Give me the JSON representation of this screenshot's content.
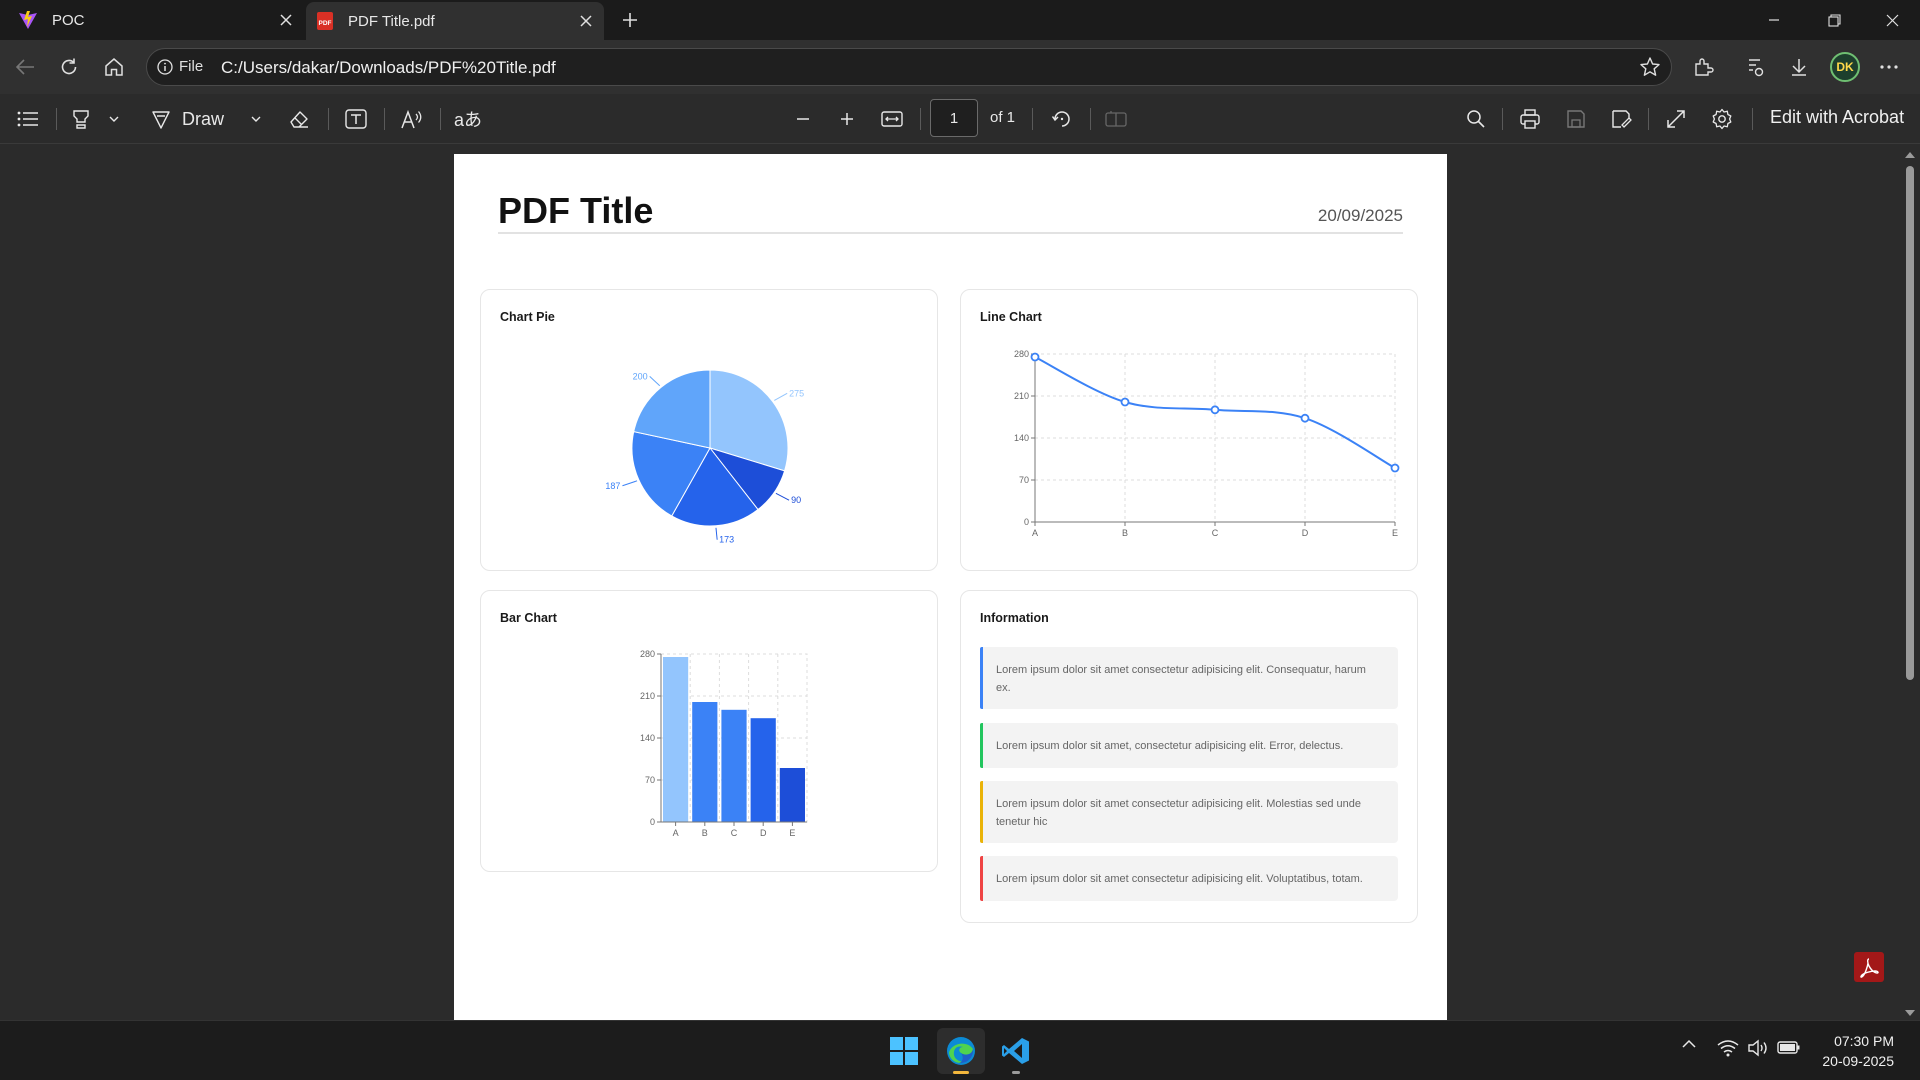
{
  "browser": {
    "tabs": [
      {
        "title": "POC",
        "icon": "vite-logo-icon"
      },
      {
        "title": "PDF Title.pdf",
        "icon": "pdf-file-icon"
      }
    ],
    "address": {
      "scheme_label": "File",
      "url": "C:/Users/dakar/Downloads/PDF%20Title.pdf"
    },
    "profile_initials": "DK"
  },
  "pdf_toolbar": {
    "draw_label": "Draw",
    "page_number": "1",
    "page_total": "of 1",
    "edit_label": "Edit with Acrobat",
    "translate_glyph": "aあ"
  },
  "document": {
    "title": "PDF Title",
    "date": "20/09/2025",
    "cards": {
      "pie": "Chart Pie",
      "line": "Line Chart",
      "bar": "Bar Chart",
      "info": "Information"
    },
    "info_items": [
      {
        "text": "Lorem ipsum dolor sit amet consectetur adipisicing elit. Consequatur, harum ex.",
        "color": "#3b82f6"
      },
      {
        "text": "Lorem ipsum dolor sit amet, consectetur adipisicing elit. Error, delectus.",
        "color": "#22c55e"
      },
      {
        "text": "Lorem ipsum dolor sit amet consectetur adipisicing elit. Molestias sed unde tenetur hic",
        "color": "#eab308"
      },
      {
        "text": "Lorem ipsum dolor sit amet consectetur adipisicing elit. Voluptatibus, totam.",
        "color": "#ef4444"
      }
    ]
  },
  "chart_data": [
    {
      "type": "pie",
      "title": "Chart Pie",
      "values": [
        275,
        90,
        173,
        187,
        200
      ],
      "labels": [
        "275",
        "90",
        "173",
        "187",
        "200"
      ],
      "colors": [
        "#93c5fd",
        "#1d4ed8",
        "#2563eb",
        "#3b82f6",
        "#60a5fa"
      ]
    },
    {
      "type": "line",
      "title": "Line Chart",
      "categories": [
        "A",
        "B",
        "C",
        "D",
        "E"
      ],
      "values": [
        275,
        200,
        187,
        173,
        90
      ],
      "yticks": [
        0,
        70,
        140,
        210,
        280
      ],
      "ylim": [
        0,
        280
      ],
      "grid": true,
      "color": "#3b82f6"
    },
    {
      "type": "bar",
      "title": "Bar Chart",
      "categories": [
        "A",
        "B",
        "C",
        "D",
        "E"
      ],
      "values": [
        275,
        200,
        187,
        173,
        90
      ],
      "yticks": [
        0,
        70,
        140,
        210,
        280
      ],
      "ylim": [
        0,
        280
      ],
      "grid": true,
      "colors": [
        "#93c5fd",
        "#3b82f6",
        "#3b82f6",
        "#2563eb",
        "#1d4ed8"
      ]
    }
  ],
  "taskbar": {
    "time": "07:30 PM",
    "date": "20-09-2025",
    "apps": [
      "windows-start-icon",
      "edge-browser-icon",
      "vscode-icon"
    ]
  }
}
